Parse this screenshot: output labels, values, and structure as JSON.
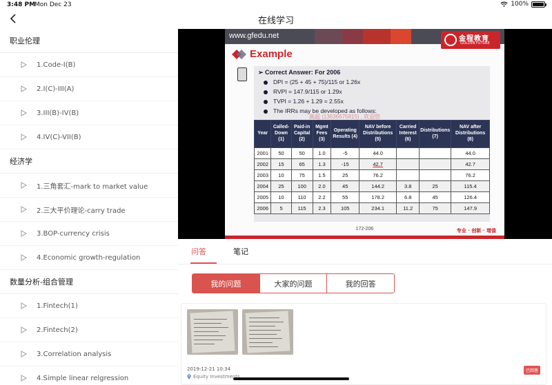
{
  "status_bar": {
    "time": "3:48 PM",
    "date": "Mon Dec 23",
    "battery": "100%"
  },
  "nav": {
    "title": "在线学习"
  },
  "sidebar": {
    "sections": [
      {
        "title": "职业伦理",
        "items": [
          "1.Code-I(B)",
          "2.I(C)-III(A)",
          "3.III(B)-IV(B)",
          "4.IV(C)-VII(B)"
        ]
      },
      {
        "title": "经济学",
        "items": [
          "1.三角套汇-mark to market value",
          "2.三大平价理论-carry trade",
          "3.BOP-currency crisis",
          "4.Economic growth-regulation"
        ]
      },
      {
        "title": "数量分析-组合管理",
        "items": [
          "1.Fintech(1)",
          "2.Fintech(2)",
          "3.Correlation analysis",
          "4.Simple linear relgression"
        ]
      }
    ]
  },
  "slide": {
    "url": "www.gfedu.net",
    "logo_cn": "金程教育",
    "logo_en": "GOLDEN FUTURE",
    "heading": "Example",
    "answer_title": "Correct Answer: For 2006",
    "bullets": [
      "DPI = (25 + 45 + 75)/115 or 1.26x",
      "RVPI = 147.9/115 or 1.29x",
      "TVPI = 1.26 + 1.29 = 2.55x",
      "The IRRs may be developed as follows:"
    ],
    "watermark": "高超 (13636675815) , 欢迎您",
    "table": {
      "headers": [
        "Year",
        "Called-Down (1)",
        "Paid-in Capital (2)",
        "Mgmt Fees (3)",
        "Operating Results (4)",
        "NAV before Distributions (5)",
        "Carried Interest (6)",
        "Distributions (7)",
        "NAV after Distributions (8)"
      ],
      "rows": [
        [
          "2001",
          "50",
          "50",
          "1.0",
          "-5",
          "44.0",
          "",
          "",
          "44.0"
        ],
        [
          "2002",
          "15",
          "65",
          "1.3",
          "-15",
          "42.7",
          "",
          "",
          "42.7"
        ],
        [
          "2003",
          "10",
          "75",
          "1.5",
          "25",
          "76.2",
          "",
          "",
          "76.2"
        ],
        [
          "2004",
          "25",
          "100",
          "2.0",
          "45",
          "144.2",
          "3.8",
          "25",
          "115.4"
        ],
        [
          "2005",
          "10",
          "110",
          "2.2",
          "55",
          "178.2",
          "6.8",
          "45",
          "126.4"
        ],
        [
          "2006",
          "5",
          "115",
          "2.3",
          "105",
          "234.1",
          "11.2",
          "75",
          "147.9"
        ]
      ]
    },
    "page_number": "172-206",
    "slogan": "专业 · 创新 · 增值"
  },
  "tabs": [
    {
      "label": "问答",
      "active": true
    },
    {
      "label": "笔记",
      "active": false
    }
  ],
  "segments": [
    {
      "label": "我的问题",
      "active": true
    },
    {
      "label": "大家的问题",
      "active": false
    },
    {
      "label": "我的回答",
      "active": false
    }
  ],
  "question": {
    "timestamp": "2019-12-21 10:34",
    "location": "Equity Investments",
    "badge": "已回答"
  },
  "colors": {
    "accent": "#d9534f",
    "slide_red": "#c9262c",
    "table_header": "#2c3556"
  }
}
